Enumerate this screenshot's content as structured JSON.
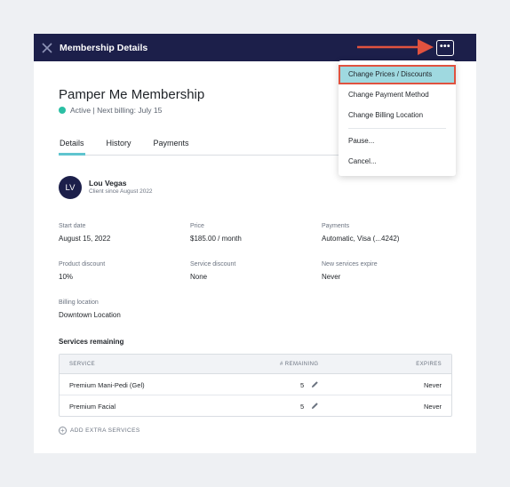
{
  "window": {
    "title": "Membership Details"
  },
  "membership": {
    "name": "Pamper Me Membership",
    "status": "Active | Next billing: July 15",
    "status_color": "#2bbfa4"
  },
  "tabs": [
    {
      "label": "Details",
      "active": true
    },
    {
      "label": "History",
      "active": false
    },
    {
      "label": "Payments",
      "active": false
    }
  ],
  "client": {
    "initials": "LV",
    "name": "Lou Vegas",
    "since": "Client since August 2022"
  },
  "fields": {
    "start_date": {
      "label": "Start date",
      "value": "August 15, 2022"
    },
    "price": {
      "label": "Price",
      "value": "$185.00 / month"
    },
    "payments": {
      "label": "Payments",
      "value": "Automatic, Visa (...4242)"
    },
    "product_discount": {
      "label": "Product discount",
      "value": "10%"
    },
    "service_discount": {
      "label": "Service discount",
      "value": "None"
    },
    "new_services_expire": {
      "label": "New services expire",
      "value": "Never"
    },
    "billing_location": {
      "label": "Billing location",
      "value": "Downtown Location"
    }
  },
  "services": {
    "title": "Services remaining",
    "columns": {
      "service": "SERVICE",
      "remaining": "# REMAINING",
      "expires": "EXPIRES"
    },
    "rows": [
      {
        "service": "Premium Mani-Pedi (Gel)",
        "remaining": "5",
        "expires": "Never"
      },
      {
        "service": "Premium Facial",
        "remaining": "5",
        "expires": "Never"
      }
    ],
    "add_label": "ADD EXTRA SERVICES"
  },
  "menu": {
    "items": [
      "Change Prices / Discounts",
      "Change Payment Method",
      "Change Billing Location",
      "Pause...",
      "Cancel..."
    ],
    "highlight_color": "#9fd9e0",
    "highlight_border": "#e0523f"
  },
  "icons": {
    "close": "close-icon",
    "more": "more-icon",
    "pencil": "pencil-icon",
    "plus": "plus-circle-icon",
    "arrow": "red-arrow-annotation"
  },
  "colors": {
    "header_bg": "#1c1f4a",
    "tab_accent": "#5fc4cf",
    "background": "#eef0f3"
  }
}
